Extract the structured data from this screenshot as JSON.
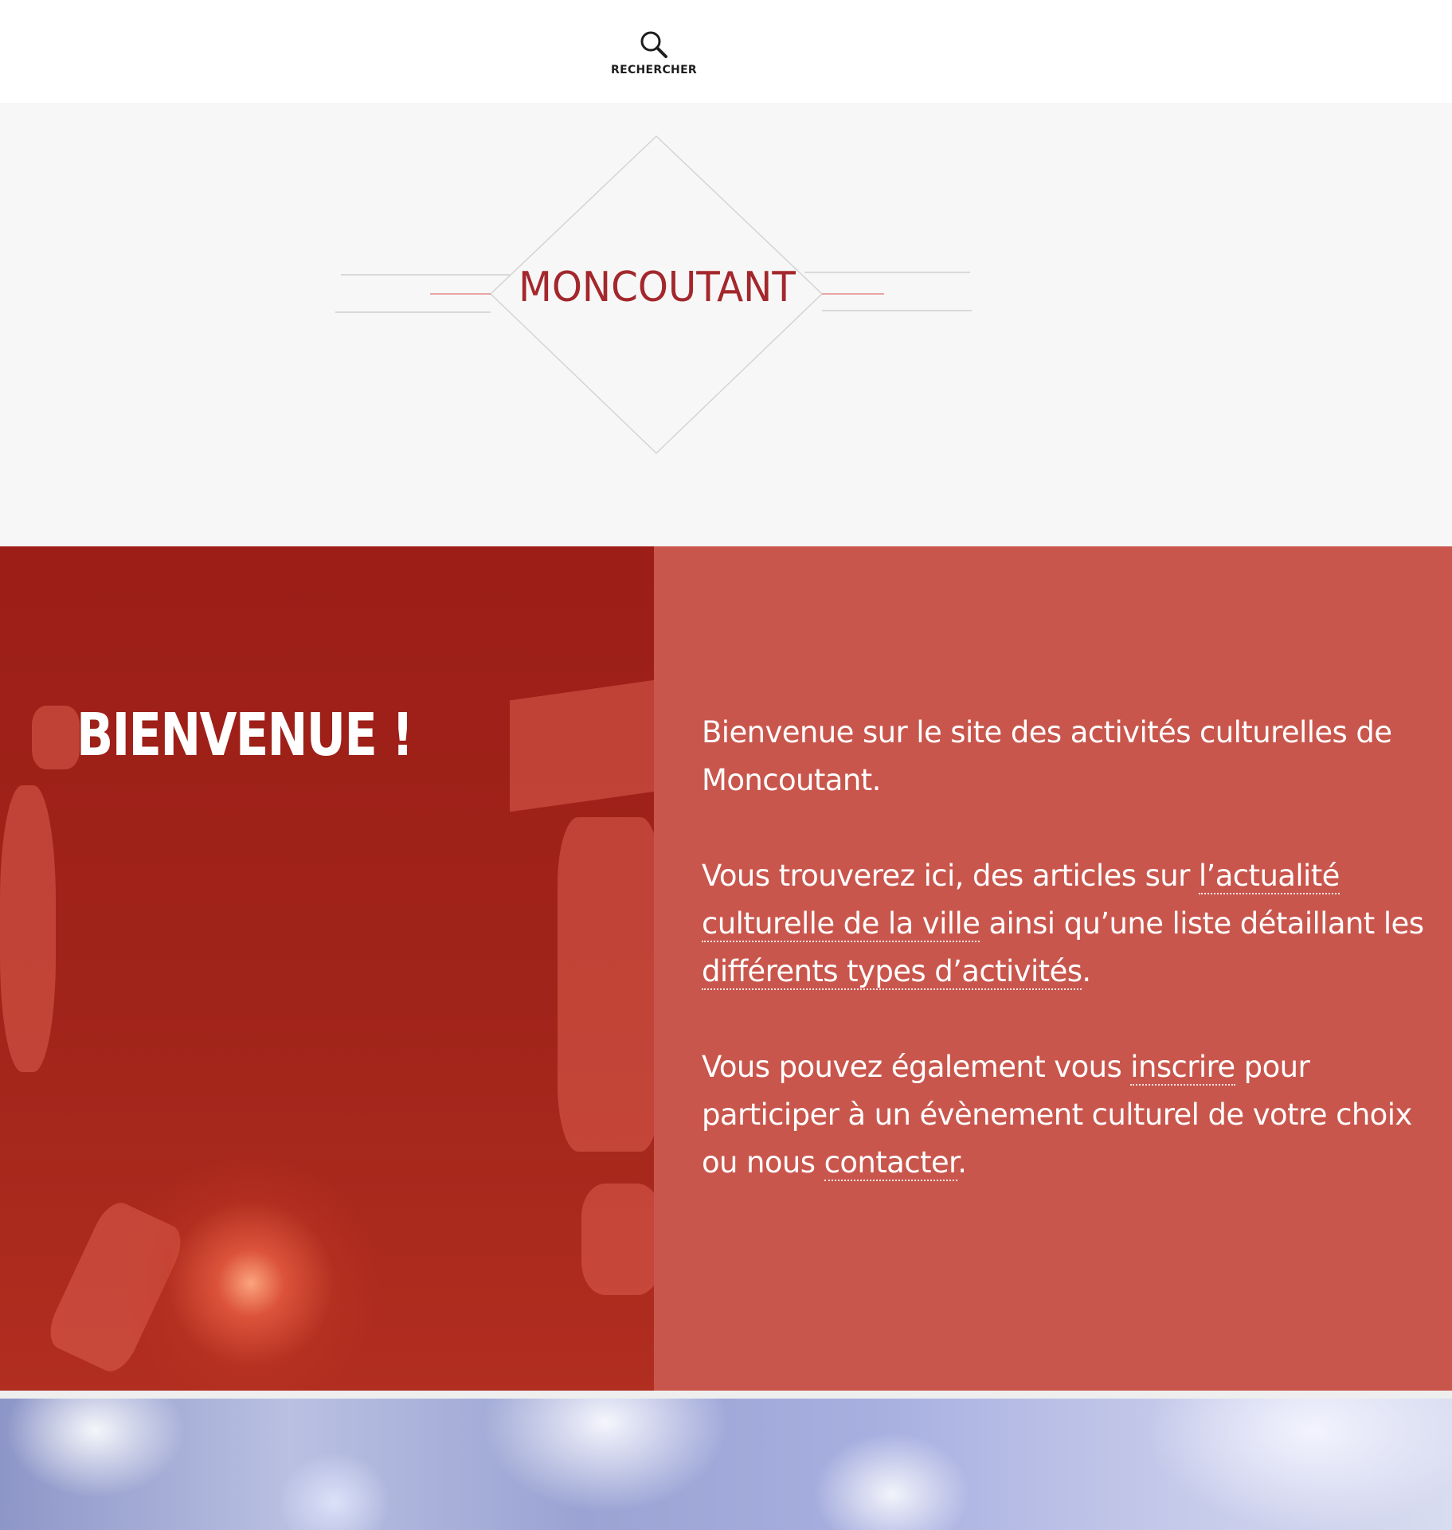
{
  "header": {
    "search_label": "RECHERCHER",
    "search_icon": "magnifier-icon"
  },
  "logo": {
    "text": "MONCOUTANT",
    "color": "#a3272c"
  },
  "welcome": {
    "title": "BIENVENUE !",
    "paragraph1": "Bienvenue sur le site des activités culturelles de Moncoutant.",
    "paragraph2": {
      "before_link1": "Vous trouverez ici, des articles sur ",
      "link1": "l’actualité culturelle de la ville",
      "between": " ainsi qu’une liste détaillant les ",
      "link2": "différents types d’activités",
      "after": "."
    },
    "paragraph3": {
      "before_link1": "Vous pouvez également vous ",
      "link1": "inscrire",
      "between": " pour participer à un évènement culturel de votre choix ou nous ",
      "link2": "contacter",
      "after": "."
    },
    "colors": {
      "left_panel": "#9c1e17",
      "right_panel": "#c9564c"
    }
  }
}
